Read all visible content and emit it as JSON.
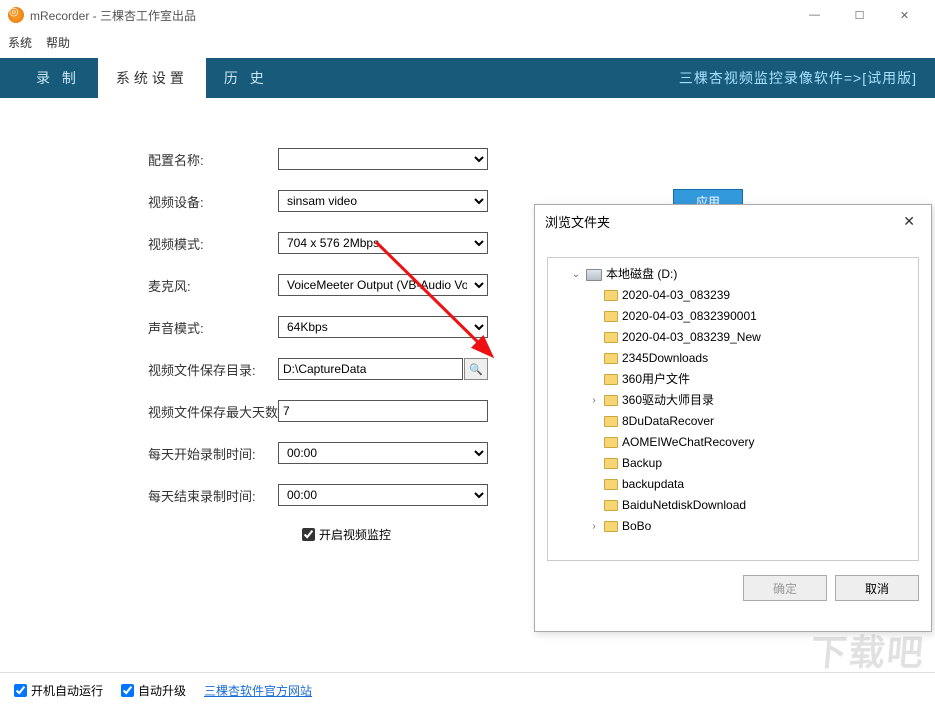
{
  "titlebar": {
    "title": "mRecorder - 三棵杏工作室出品"
  },
  "menu": {
    "system": "系统",
    "help": "帮助"
  },
  "tabs": {
    "record": "录 制",
    "settings": "系统设置",
    "history": "历 史",
    "rightText": "三棵杏视频监控录像软件=>[试用版]"
  },
  "labels": {
    "configName": "配置名称:",
    "videoDevice": "视频设备:",
    "videoMode": "视频模式:",
    "mic": "麦克风:",
    "audioMode": "声音模式:",
    "saveDir": "视频文件保存目录:",
    "maxDays": "视频文件保存最大天数:",
    "startTime": "每天开始录制时间:",
    "endTime": "每天结束录制时间:",
    "enableMonitor": "开启视频监控",
    "apply": "应用"
  },
  "values": {
    "configName": "",
    "videoDevice": "sinsam video",
    "videoMode": "704 x 576 2Mbps",
    "mic": "VoiceMeeter Output (VB-Audio Vo",
    "audioMode": "64Kbps",
    "saveDir": "D:\\CaptureData",
    "maxDays": "7",
    "startTime": "00:00",
    "endTime": "00:00"
  },
  "dialog": {
    "title": "浏览文件夹",
    "ok": "确定",
    "cancel": "取消",
    "drive": "本地磁盘 (D:)",
    "items": [
      "2020-04-03_083239",
      "2020-04-03_0832390001",
      "2020-04-03_083239_New",
      "2345Downloads",
      "360用户文件",
      "360驱动大师目录",
      "8DuDataRecover",
      "AOMEIWeChatRecovery",
      "Backup",
      "backupdata",
      "BaiduNetdiskDownload",
      "BoBo"
    ],
    "expandable": [
      5,
      11
    ]
  },
  "footer": {
    "autoStart": "开机自动运行",
    "autoUpgrade": "自动升级",
    "link": "三棵杏软件官方网站"
  },
  "watermark": "下载吧"
}
